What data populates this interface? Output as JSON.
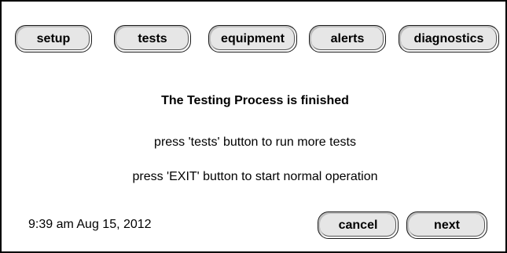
{
  "nav": {
    "setup_label": "setup",
    "tests_label": "tests",
    "equipment_label": "equipment",
    "alerts_label": "alerts",
    "diagnostics_label": "diagnostics"
  },
  "message": {
    "title": "The Testing Process is finished",
    "line1": "press 'tests' button to run more tests",
    "line2": "press 'EXIT' button to start normal operation"
  },
  "footer": {
    "datetime": "9:39 am Aug 15, 2012",
    "cancel_label": "cancel",
    "next_label": "next"
  }
}
